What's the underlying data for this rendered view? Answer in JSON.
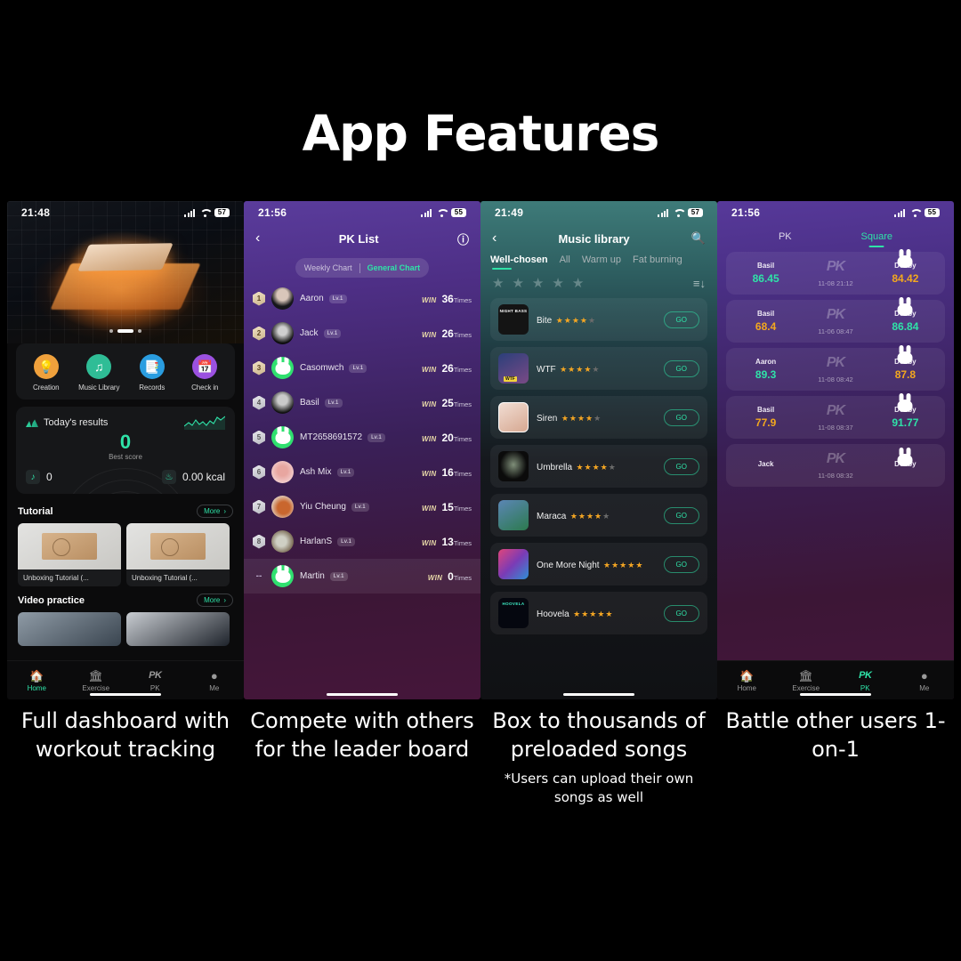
{
  "page": {
    "title": "App Features",
    "background": "#000000",
    "accent": "#2fe3a8"
  },
  "phones": [
    {
      "id": "home-dashboard",
      "status": {
        "time": "21:48",
        "battery": "57"
      },
      "carousel": {
        "dots": 3,
        "active": 1
      },
      "quick_actions": [
        {
          "label": "Creation",
          "icon": "lightbulb-icon",
          "color": "#f0a13c"
        },
        {
          "label": "Music Library",
          "icon": "music-note-icon",
          "color": "#2fbd96"
        },
        {
          "label": "Records",
          "icon": "records-icon",
          "color": "#2a9de0"
        },
        {
          "label": "Check in",
          "icon": "calendar-check-icon",
          "color": "#9b51e0"
        }
      ],
      "results": {
        "title": "Today's results",
        "score": "0",
        "score_label": "Best score",
        "songs_count": "0",
        "calories": "0.00 kcal"
      },
      "sections": [
        {
          "heading": "Tutorial",
          "more_label": "More",
          "items": [
            {
              "caption": "Unboxing Tutorial (..."
            },
            {
              "caption": "Unboxing Tutorial (..."
            }
          ]
        },
        {
          "heading": "Video practice",
          "more_label": "More",
          "items": []
        }
      ],
      "tabbar": {
        "active": "Home",
        "items": [
          {
            "label": "Home",
            "icon": "home-icon"
          },
          {
            "label": "Exercise",
            "icon": "exercise-icon"
          },
          {
            "label": "PK",
            "icon": "pk-icon"
          },
          {
            "label": "Me",
            "icon": "profile-icon"
          }
        ]
      }
    },
    {
      "id": "pk-list",
      "status": {
        "time": "21:56",
        "battery": "55"
      },
      "navbar": {
        "title": "PK List",
        "back_icon": "chevron-left-icon",
        "info_icon": "info-icon"
      },
      "segment": {
        "inactive": "Weekly Chart",
        "active": "General Chart"
      },
      "columns": {
        "win": "WIN",
        "unit": "Times"
      },
      "rows": [
        {
          "rank": "1",
          "name": "Aaron",
          "level": "Lv.1",
          "win": "WIN",
          "count": "36",
          "unit": "Times",
          "avatar": "a1",
          "me": false
        },
        {
          "rank": "2",
          "name": "Jack",
          "level": "Lv.1",
          "win": "WIN",
          "count": "26",
          "unit": "Times",
          "avatar": "a2",
          "me": false
        },
        {
          "rank": "3",
          "name": "Casomwch",
          "level": "Lv.1",
          "win": "WIN",
          "count": "26",
          "unit": "Times",
          "avatar": "bunny",
          "me": false
        },
        {
          "rank": "4",
          "name": "Basil",
          "level": "Lv.1",
          "win": "WIN",
          "count": "25",
          "unit": "Times",
          "avatar": "a3",
          "me": false
        },
        {
          "rank": "5",
          "name": "MT2658691572",
          "level": "Lv.1",
          "win": "WIN",
          "count": "20",
          "unit": "Times",
          "avatar": "bunny",
          "me": false
        },
        {
          "rank": "6",
          "name": "Ash Mix",
          "level": "Lv.1",
          "win": "WIN",
          "count": "16",
          "unit": "Times",
          "avatar": "a4",
          "me": false
        },
        {
          "rank": "7",
          "name": "Yiu Cheung",
          "level": "Lv.1",
          "win": "WIN",
          "count": "15",
          "unit": "Times",
          "avatar": "a5",
          "me": false
        },
        {
          "rank": "8",
          "name": "HarlanS",
          "level": "Lv.1",
          "win": "WIN",
          "count": "13",
          "unit": "Times",
          "avatar": "a6",
          "me": false
        },
        {
          "rank": "--",
          "name": "Martin",
          "level": "Lv.1",
          "win": "WIN",
          "count": "0",
          "unit": "Times",
          "avatar": "bunny",
          "me": true
        }
      ]
    },
    {
      "id": "music-library",
      "status": {
        "time": "21:49",
        "battery": "57"
      },
      "navbar": {
        "title": "Music library",
        "back_icon": "chevron-left-icon",
        "search_icon": "search-icon"
      },
      "tabs": [
        {
          "label": "Well-chosen",
          "active": true
        },
        {
          "label": "All",
          "active": false
        },
        {
          "label": "Warm up",
          "active": false
        },
        {
          "label": "Fat burning",
          "active": false
        }
      ],
      "filter": {
        "stars": 5,
        "sort_icon": "sort-icon"
      },
      "songs": [
        {
          "name": "Bite",
          "rating": 4,
          "action": "GO",
          "cover": "c1"
        },
        {
          "name": "WTF",
          "rating": 4,
          "action": "GO",
          "cover": "c2"
        },
        {
          "name": "Siren",
          "rating": 4,
          "action": "GO",
          "cover": "c3"
        },
        {
          "name": "Umbrella",
          "rating": 4,
          "action": "GO",
          "cover": "c4"
        },
        {
          "name": "Maraca",
          "rating": 4,
          "action": "GO",
          "cover": "c5"
        },
        {
          "name": "One More Night",
          "rating": 5,
          "action": "GO",
          "cover": "c6"
        },
        {
          "name": "Hoovela",
          "rating": 5,
          "action": "GO",
          "cover": "c7"
        }
      ]
    },
    {
      "id": "pk-square",
      "status": {
        "time": "21:56",
        "battery": "55"
      },
      "tabs": [
        {
          "label": "PK",
          "active": false
        },
        {
          "label": "Square",
          "active": true
        }
      ],
      "duels": [
        {
          "left_name": "Basil",
          "left_score": "86.45",
          "left_win": true,
          "date": "11-08 21:12",
          "right_name": "Debby",
          "right_score": "84.42",
          "right_win": false,
          "left_avatar": "a3"
        },
        {
          "left_name": "Basil",
          "left_score": "68.4",
          "left_win": false,
          "date": "11-06 08:47",
          "right_name": "Debby",
          "right_score": "86.84",
          "right_win": true,
          "left_avatar": "a3"
        },
        {
          "left_name": "Aaron",
          "left_score": "89.3",
          "left_win": true,
          "date": "11-08 08:42",
          "right_name": "Debby",
          "right_score": "87.8",
          "right_win": false,
          "left_avatar": "a1"
        },
        {
          "left_name": "Basil",
          "left_score": "77.9",
          "left_win": false,
          "date": "11-08 08:37",
          "right_name": "Debby",
          "right_score": "91.77",
          "right_win": true,
          "left_avatar": "a3"
        },
        {
          "left_name": "Jack",
          "left_score": "",
          "left_win": false,
          "date": "11-08 08:32",
          "right_name": "Debby",
          "right_score": "",
          "right_win": false,
          "left_avatar": "a2"
        }
      ],
      "pk_badge": "PK",
      "tabbar": {
        "active": "PK",
        "items": [
          {
            "label": "Home",
            "icon": "home-icon"
          },
          {
            "label": "Exercise",
            "icon": "exercise-icon"
          },
          {
            "label": "PK",
            "icon": "pk-icon"
          },
          {
            "label": "Me",
            "icon": "profile-icon"
          }
        ]
      }
    }
  ],
  "captions": [
    {
      "main": "Full dashboard with workout tracking",
      "sub": ""
    },
    {
      "main": "Compete with others for the leader board",
      "sub": ""
    },
    {
      "main": "Box to thousands of preloaded songs",
      "sub": "*Users can upload their own songs as well"
    },
    {
      "main": "Battle other users 1-on-1",
      "sub": ""
    }
  ]
}
